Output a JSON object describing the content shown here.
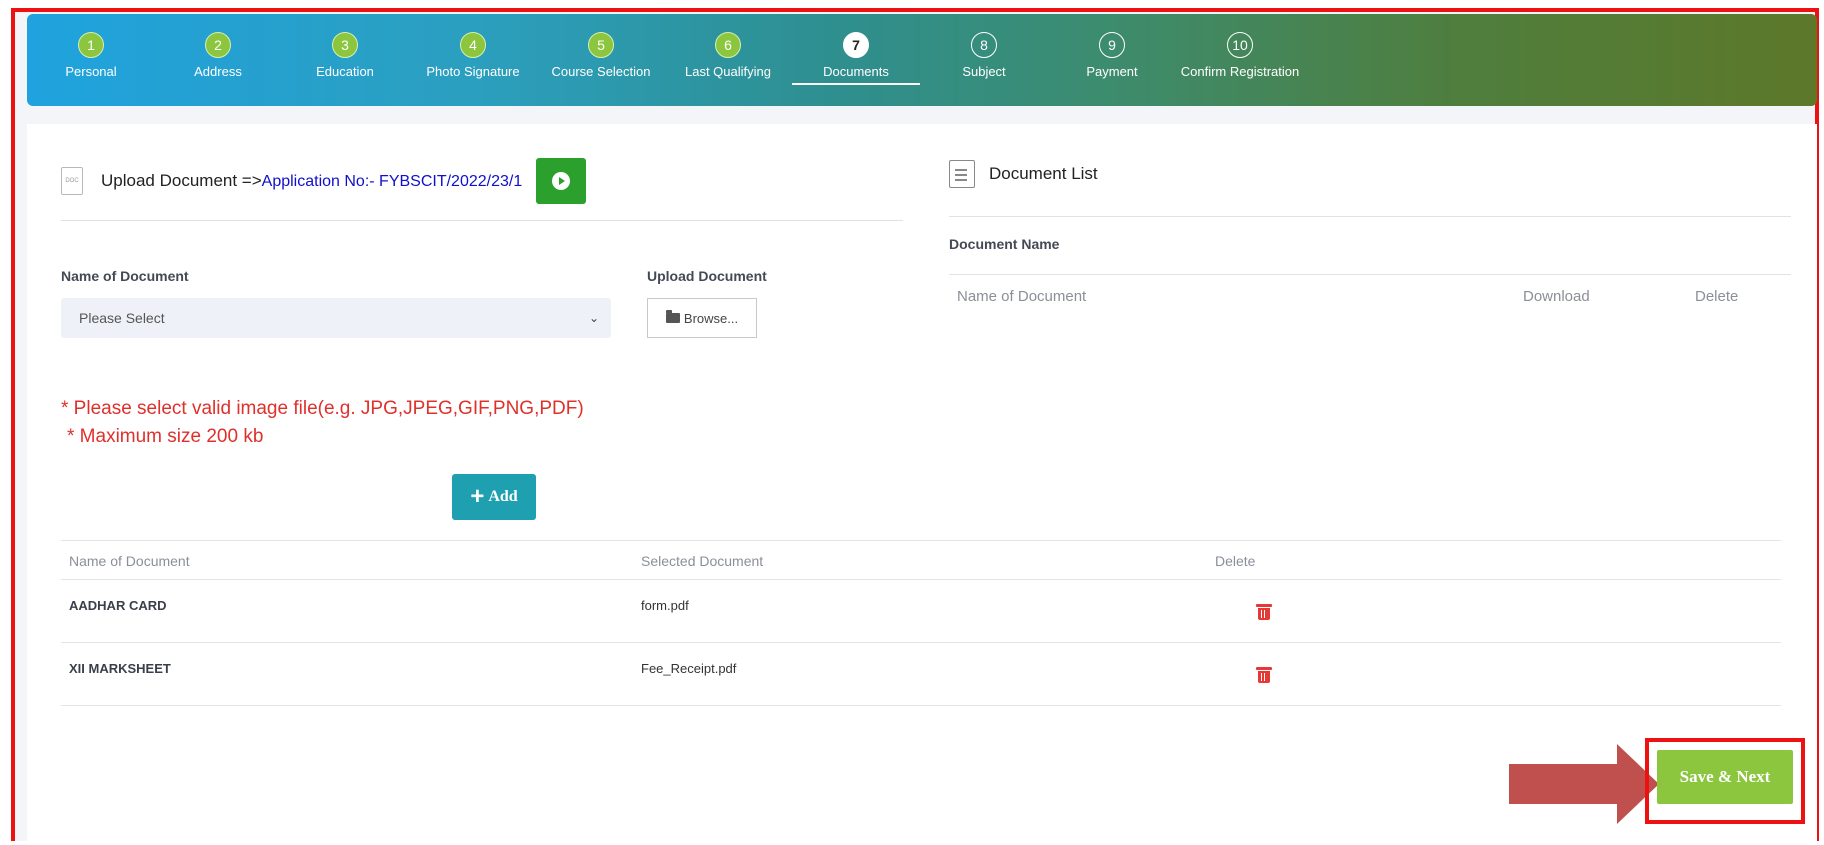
{
  "steps": [
    {
      "num": "1",
      "label": "Personal",
      "state": "done"
    },
    {
      "num": "2",
      "label": "Address",
      "state": "done"
    },
    {
      "num": "3",
      "label": "Education",
      "state": "done"
    },
    {
      "num": "4",
      "label": "Photo Signature",
      "state": "done"
    },
    {
      "num": "5",
      "label": "Course Selection",
      "state": "done"
    },
    {
      "num": "6",
      "label": "Last Qualifying",
      "state": "done"
    },
    {
      "num": "7",
      "label": "Documents",
      "state": "active"
    },
    {
      "num": "8",
      "label": "Subject",
      "state": "todo"
    },
    {
      "num": "9",
      "label": "Payment",
      "state": "todo"
    },
    {
      "num": "10",
      "label": "Confirm Registration",
      "state": "todo"
    }
  ],
  "upload": {
    "title": "Upload Document =>",
    "application": "Application No:- FYBSCIT/2022/23/1",
    "doc_icon_text": "DOC",
    "name_label": "Name of Document",
    "upload_label": "Upload Document",
    "select_value": "Please Select",
    "browse_label": "Browse...",
    "note1": "* Please select valid image file(e.g. JPG,JPEG,GIF,PNG,PDF)",
    "note2": "* Maximum size 200 kb",
    "add_label": "Add"
  },
  "selected_table": {
    "headers": [
      "Name of Document",
      "Selected Document",
      "Delete"
    ],
    "rows": [
      {
        "name": "AADHAR CARD",
        "file": "form.pdf"
      },
      {
        "name": "XII MARKSHEET",
        "file": "Fee_Receipt.pdf"
      }
    ]
  },
  "document_list": {
    "title": "Document List",
    "subtitle": "Document Name",
    "columns": [
      "Name of Document",
      "Download",
      "Delete"
    ]
  },
  "actions": {
    "save_next": "Save & Next"
  },
  "colors": {
    "step_done": "#8cc63f",
    "play_button": "#2ca02c",
    "add_button": "#1fa0b0",
    "save_button": "#8cc63f",
    "note_text": "#e0302b",
    "highlight": "#ee1111",
    "arrow": "#c0504d"
  }
}
